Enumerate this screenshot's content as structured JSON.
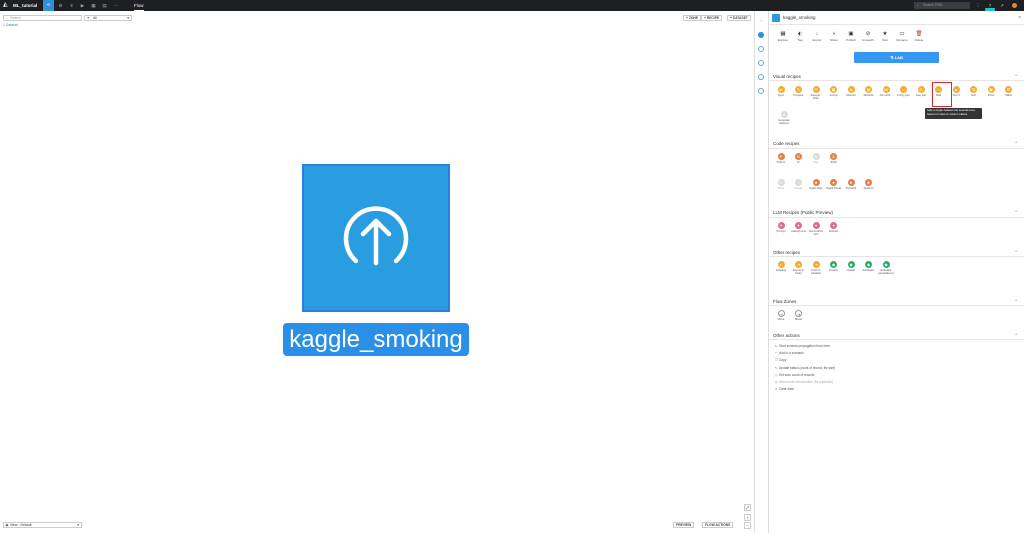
{
  "topbar": {
    "project": "ML_tutorial",
    "flow_label": "Flow",
    "search_placeholder": "Search DSS..."
  },
  "flow_toolbar": {
    "search_placeholder": "Search",
    "filter_value": "All",
    "dataset_link": "1 Dataset",
    "zone_btn": "+ ZONE",
    "recipe_btn": "+ RECIPE",
    "dataset_btn": "+ DATASET"
  },
  "node": {
    "label": "kaggle_smoking"
  },
  "bottom": {
    "view_label": "View : Default",
    "preview_btn": "PREVIEW",
    "flow_actions_btn": "FLOW ACTIONS"
  },
  "panel": {
    "title": "kaggle_smoking",
    "actions": [
      {
        "label": "Explore",
        "icon": "table-icon"
      },
      {
        "label": "Tag",
        "icon": "tag-icon"
      },
      {
        "label": "Export",
        "icon": "download-icon"
      },
      {
        "label": "Share",
        "icon": "share-icon"
      },
      {
        "label": "Publish",
        "icon": "publish-icon"
      },
      {
        "label": "Unwatch",
        "icon": "eye-off-icon"
      },
      {
        "label": "Star",
        "icon": "star-icon"
      },
      {
        "label": "Rename",
        "icon": "rename-icon"
      },
      {
        "label": "Delete",
        "icon": "trash-icon"
      }
    ],
    "lab_label": "LAB",
    "visual_title": "Visual recipes",
    "visual_recipes": [
      {
        "label": "Sync",
        "sym": "⇄"
      },
      {
        "label": "Prepare",
        "sym": "✎"
      },
      {
        "label": "Sample / Filter",
        "sym": "▽"
      },
      {
        "label": "Group",
        "sym": "▦"
      },
      {
        "label": "Distinct",
        "sym": "◈"
      },
      {
        "label": "Window",
        "sym": "▤"
      },
      {
        "label": "Join with...",
        "sym": "⋈"
      },
      {
        "label": "Fuzzy join",
        "sym": "≈"
      },
      {
        "label": "Geo join",
        "sym": "◎"
      },
      {
        "label": "Split",
        "sym": "⑂"
      },
      {
        "label": "Top N",
        "sym": "▲"
      },
      {
        "label": "Sort",
        "sym": "⇅"
      },
      {
        "label": "Pivot",
        "sym": "▣"
      },
      {
        "label": "Stack",
        "sym": "☰"
      }
    ],
    "generate_features": "Generate features",
    "split_tooltip": "Split a single dataset into several ones, based on rules or column values",
    "code_title": "Code recipes",
    "code_recipes": [
      {
        "label": "Python",
        "sym": "P",
        "dim": false
      },
      {
        "label": "R",
        "sym": "R",
        "dim": false
      },
      {
        "label": "SQL",
        "sym": "S",
        "dim": true
      },
      {
        "label": "Shell",
        "sym": "$",
        "dim": false
      }
    ],
    "code_recipes_2": [
      {
        "label": "Pivot",
        "sym": "H",
        "dim": true
      },
      {
        "label": "Impala",
        "sym": "I",
        "dim": true
      },
      {
        "label": "Spark SQL",
        "sym": "★",
        "dim": false
      },
      {
        "label": "Spark Scala",
        "sym": "★",
        "dim": false
      },
      {
        "label": "PySpark",
        "sym": "★",
        "dim": false
      },
      {
        "label": "Spark R",
        "sym": "★",
        "dim": false
      }
    ],
    "llm_title": "LLM Recipes (Public Preview)",
    "llm_recipes": [
      {
        "label": "Prompt",
        "sym": "✦"
      },
      {
        "label": "Classify text",
        "sym": "✦"
      },
      {
        "label": "Summarize text",
        "sym": "✦"
      },
      {
        "label": "Embed",
        "sym": "✦"
      }
    ],
    "other_title": "Other recipes",
    "other_recipes": [
      {
        "label": "Labeling",
        "sym": "◐",
        "color": "orange"
      },
      {
        "label": "Export to folder",
        "sym": "⇥",
        "color": "orange"
      },
      {
        "label": "Push to editable",
        "sym": "⇥",
        "color": "orange"
      },
      {
        "label": "Predict",
        "sym": "◆",
        "color": "green"
      },
      {
        "label": "Cluster",
        "sym": "◆",
        "color": "green"
      },
      {
        "label": "Evaluate",
        "sym": "◆",
        "color": "green"
      },
      {
        "label": "Evaluate (standalone)",
        "sym": "◆",
        "color": "green"
      }
    ],
    "zones_title": "Flow Zones",
    "zones": [
      {
        "label": "Move",
        "sym": "⇢"
      },
      {
        "label": "Share",
        "sym": "⇢"
      }
    ],
    "actions_title": "Other actions",
    "other_actions": [
      {
        "label": "Start schema propagation from here",
        "sym": "↻",
        "dim": false
      },
      {
        "label": "Add to a scenario",
        "sym": "+",
        "dim": false
      },
      {
        "label": "Copy",
        "sym": "❐",
        "dim": false
      },
      {
        "label": "Update status (count of record, file size)",
        "sym": "↻",
        "dim": false
      },
      {
        "label": "Set auto count of records",
        "sym": "◷",
        "dim": false
      },
      {
        "label": "Allow build virtualization (for pipelines)",
        "sym": "◎",
        "dim": true
      },
      {
        "label": "Clear data",
        "sym": "✕",
        "dim": false
      }
    ]
  }
}
